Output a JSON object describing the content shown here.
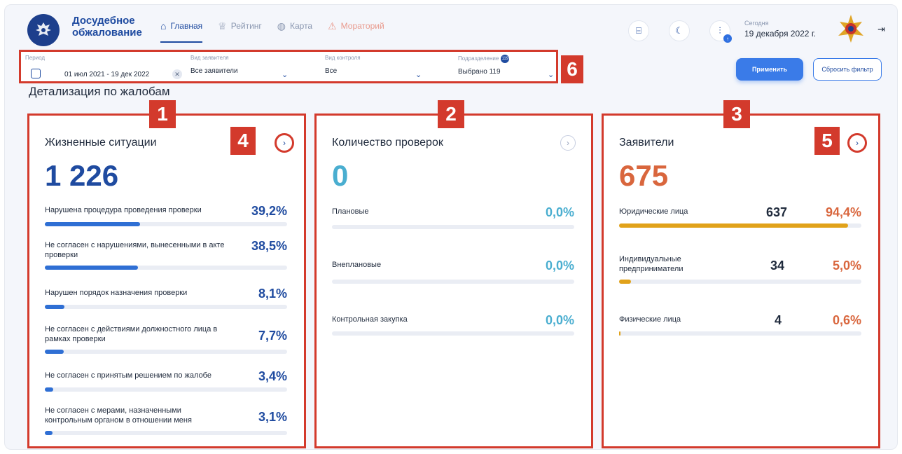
{
  "header": {
    "brand": "Досудебное обжалование",
    "nav": [
      {
        "label": "Главная",
        "icon": "home-icon"
      },
      {
        "label": "Рейтинг",
        "icon": "trophy-icon"
      },
      {
        "label": "Карта",
        "icon": "globe-icon"
      },
      {
        "label": "Мораторий",
        "icon": "warning-icon"
      }
    ],
    "today_label": "Сегодня",
    "today_value": "19 декабря 2022 г."
  },
  "filters": {
    "period_label": "Период",
    "period_value": "01 июл 2021  -  19 дек 2022",
    "applicant_label": "Вид заявителя",
    "applicant_value": "Все заявители",
    "control_label": "Вид контроля",
    "control_value": "Все",
    "division_label": "Подразделение",
    "division_count": "119",
    "division_value": "Выбрано 119",
    "apply": "Применить",
    "reset": "Сбросить фильтр"
  },
  "section_title": "Детализация по жалобам",
  "callouts": [
    "1",
    "2",
    "3",
    "4",
    "5",
    "6"
  ],
  "colors": {
    "blue": "#1f4ba0",
    "cyan": "#4aaed0",
    "orange": "#d9663d",
    "highlight": "#d33a2c"
  },
  "cards": {
    "situations": {
      "title": "Жизненные ситуации",
      "total": "1 226",
      "rows": [
        {
          "label": "Нарушена процедура проведения проверки",
          "pct": "39,2%",
          "value": 39.2
        },
        {
          "label": "Не согласен с нарушениями, вынесенными в акте проверки",
          "pct": "38,5%",
          "value": 38.5
        },
        {
          "label": "Нарушен порядок назначения проверки",
          "pct": "8,1%",
          "value": 8.1
        },
        {
          "label": "Не согласен с действиями должностного лица в рамках проверки",
          "pct": "7,7%",
          "value": 7.7
        },
        {
          "label": "Не согласен с принятым решением по жалобе",
          "pct": "3,4%",
          "value": 3.4
        },
        {
          "label": "Не согласен с мерами, назначенными контрольным органом в отношении меня",
          "pct": "3,1%",
          "value": 3.1
        }
      ]
    },
    "inspections": {
      "title": "Количество проверок",
      "total": "0",
      "rows": [
        {
          "label": "Плановые",
          "pct": "0,0%",
          "value": 0
        },
        {
          "label": "Внеплановые",
          "pct": "0,0%",
          "value": 0
        },
        {
          "label": "Контрольная закупка",
          "pct": "0,0%",
          "value": 0
        }
      ]
    },
    "applicants": {
      "title": "Заявители",
      "total": "675",
      "rows": [
        {
          "label": "Юридические лица",
          "count": "637",
          "pct": "94,4%",
          "value": 94.4
        },
        {
          "label": "Индивидуальные предприниматели",
          "count": "34",
          "pct": "5,0%",
          "value": 5.0
        },
        {
          "label": "Физические лица",
          "count": "4",
          "pct": "0,6%",
          "value": 0.6
        }
      ]
    }
  }
}
